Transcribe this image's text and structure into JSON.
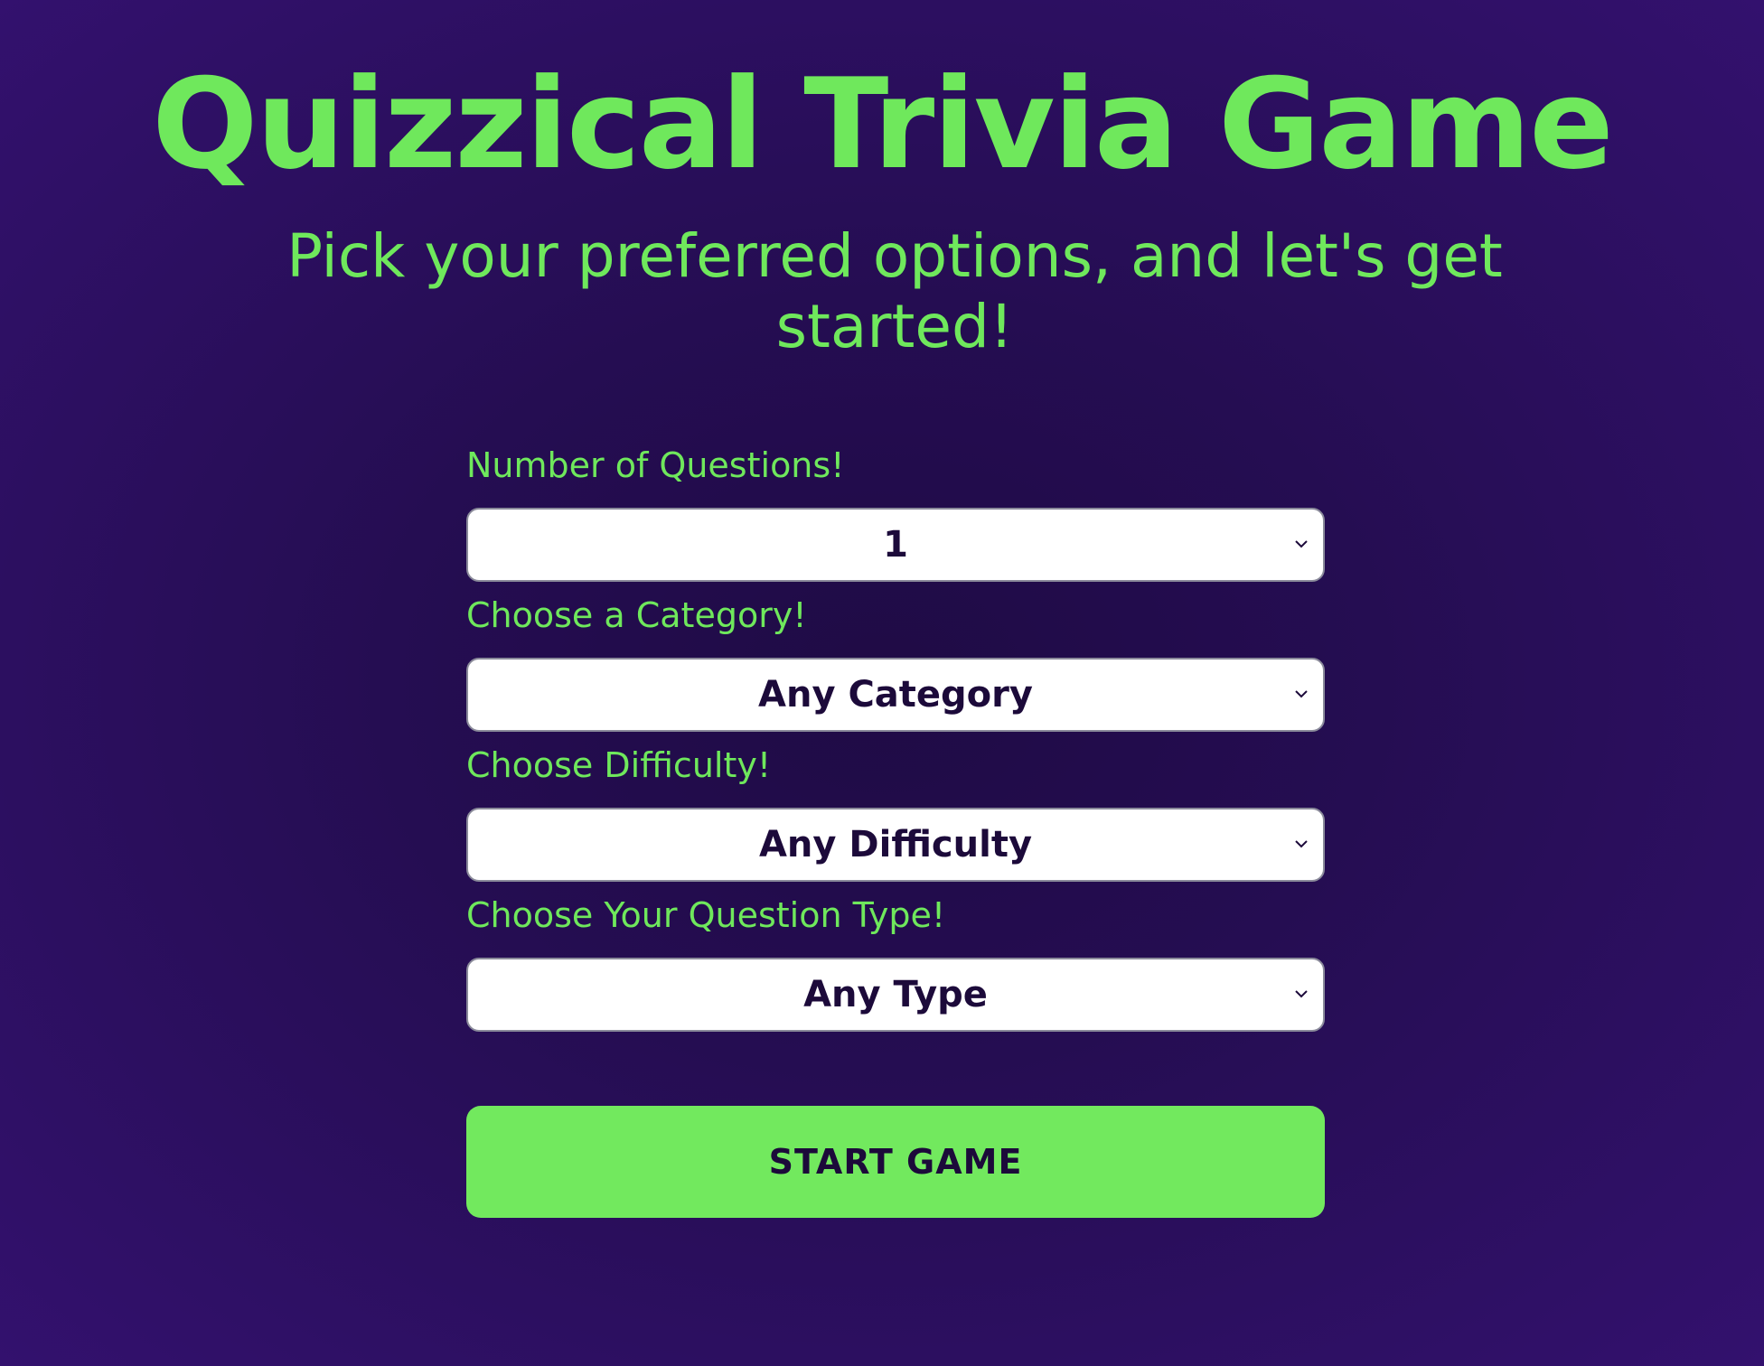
{
  "header": {
    "title": "Quizzical Trivia Game",
    "subtitle": "Pick your preferred options, and let's get started!"
  },
  "form": {
    "questions": {
      "label": "Number of Questions!",
      "value": "1"
    },
    "category": {
      "label": "Choose a Category!",
      "value": "Any Category"
    },
    "difficulty": {
      "label": "Choose Difficulty!",
      "value": "Any Difficulty"
    },
    "type": {
      "label": "Choose Your Question Type!",
      "value": "Any Type"
    }
  },
  "actions": {
    "start_label": "START GAME"
  },
  "colors": {
    "background": "#250d52",
    "accent": "#6fe85c",
    "button": "#72e95e",
    "text_dark": "#1c0a3a"
  },
  "icons": {
    "select_arrow": "chevron-down-icon"
  }
}
